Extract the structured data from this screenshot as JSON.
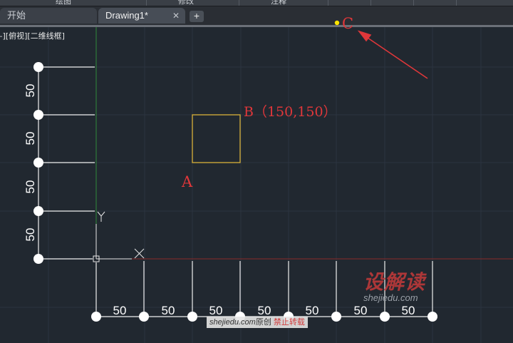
{
  "ribbon": {
    "labels": [
      "绘图",
      "修改",
      "注释"
    ]
  },
  "tabs": [
    {
      "label": "开始",
      "active": false
    },
    {
      "label": "Drawing1*",
      "active": true,
      "close": "✕"
    }
  ],
  "new_tab": "+",
  "viewport_label": "–][俯视][二维线框]",
  "drawing": {
    "point_labels": {
      "a": "A",
      "b": "B（150,150）",
      "c": "C"
    },
    "ucs": {
      "x": "X",
      "y": "Y"
    },
    "vertical_dims": [
      "50",
      "50",
      "50",
      "50"
    ],
    "horizontal_dims": [
      "50",
      "50",
      "50",
      "50",
      "50",
      "50",
      "50"
    ],
    "colors": {
      "background": "#212830",
      "rectangle": "#d9b13a",
      "x_axis": "#8a2a2a",
      "y_axis": "#2f8a3a",
      "annotation": "#e0373a",
      "point_c": "#ffe600"
    }
  },
  "watermark": {
    "logo": "设解读",
    "url": "shejiedu.com",
    "banner_url": "shejiedu.com",
    "banner_text": "原创",
    "banner_warning": "禁止转载"
  }
}
